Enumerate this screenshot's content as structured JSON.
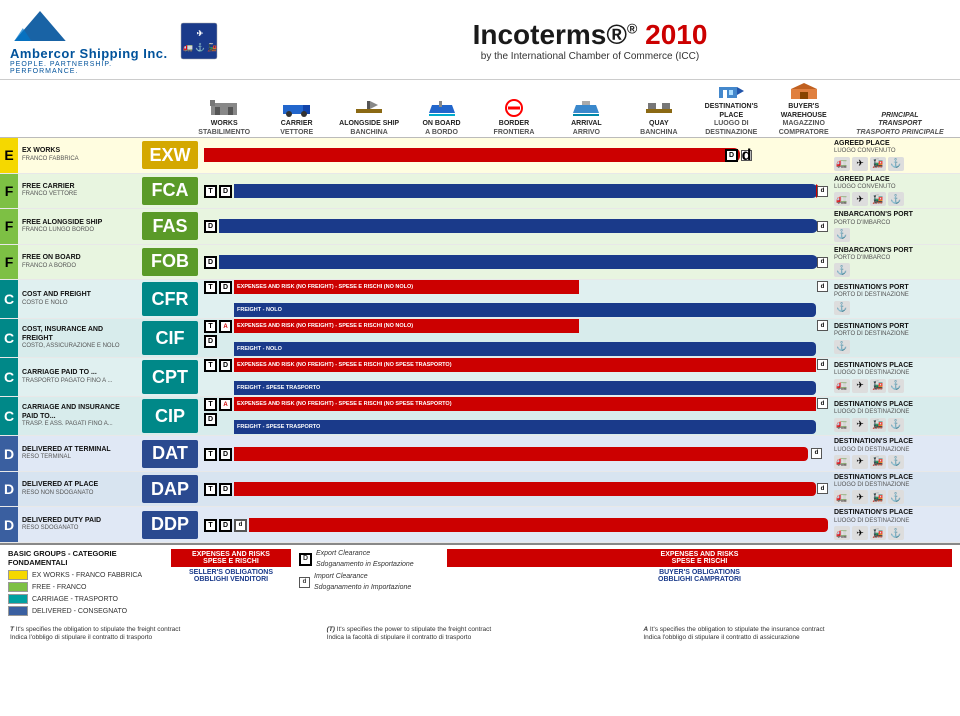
{
  "header": {
    "company": "Ambercor Shipping Inc.",
    "tagline": "PEOPLE. PARTNERSHIP. PERFORMANCE.",
    "title": "Incoterms®",
    "year": "2010",
    "subtitle": "by the International Chamber of Commerce (ICC)"
  },
  "columns": [
    {
      "main": "WORKS",
      "sub": "STABILIMENTO",
      "icon": "factory"
    },
    {
      "main": "CARRIER",
      "sub": "VETTORE",
      "icon": "truck"
    },
    {
      "main": "ALONGSIDE SHIP",
      "sub": "BANCHINA",
      "icon": "dock"
    },
    {
      "main": "ON BOARD",
      "sub": "A BORDO",
      "icon": "ship"
    },
    {
      "main": "BORDER",
      "sub": "FRONTIERA",
      "icon": "border"
    },
    {
      "main": "ARRIVAL",
      "sub": "ARRIVO",
      "icon": "arrival"
    },
    {
      "main": "QUAY",
      "sub": "BANCHINA",
      "icon": "quay"
    },
    {
      "main": "DESTINATION'S PLACE",
      "sub": "LUOGO DI DESTINAZIONE",
      "icon": "dest"
    },
    {
      "main": "BUYER'S WAREHOUSE",
      "sub": "MAGAZZINO COMPRATORE",
      "icon": "warehouse"
    }
  ],
  "last_col": {
    "main": "PRINCIPAL TRANSPORT",
    "sub": "TRASPORTO PRINCIPALE"
  },
  "rows": [
    {
      "group": "E",
      "group_color": "yellow",
      "code": "EXW",
      "desc_main": "EX WORKS",
      "desc_sub": "FRANCO FABBRICA",
      "right_main": "AGREED PLACE",
      "right_sub": "LUOGO CONVENUTO",
      "bar_type": "exw"
    },
    {
      "group": "F",
      "group_color": "green",
      "code": "FCA",
      "desc_main": "FREE CARRIER",
      "desc_sub": "FRANCO VETTORE",
      "right_main": "AGREED PLACE",
      "right_sub": "LUOGO CONVENUTO",
      "bar_type": "fca"
    },
    {
      "group": "F",
      "group_color": "green",
      "code": "FAS",
      "desc_main": "FREE ALONGSIDE SHIP",
      "desc_sub": "FRANCO LUNGO BORDO",
      "right_main": "ENBARCATION'S PORT",
      "right_sub": "PORTO D'IMBARCO",
      "bar_type": "fas"
    },
    {
      "group": "F",
      "group_color": "green",
      "code": "FOB",
      "desc_main": "FREE ON BOARD",
      "desc_sub": "FRANCO A BORDO",
      "right_main": "ENBARCATION'S PORT",
      "right_sub": "PORTO D'IMBARCO",
      "bar_type": "fob"
    },
    {
      "group": "C",
      "group_color": "teal",
      "code": "CFR",
      "desc_main": "COST AND FREIGHT",
      "desc_sub": "COSTO E NOLO",
      "right_main": "DESTINATION'S PORT",
      "right_sub": "PORTO DI DESTINAZIONE",
      "bar_type": "cfr"
    },
    {
      "group": "C",
      "group_color": "teal",
      "code": "CIF",
      "desc_main": "COST, INSURANCE AND FREIGHT",
      "desc_sub": "COSTO, ASSICURAZIONE E NOLO",
      "right_main": "DESTINATION'S PORT",
      "right_sub": "PORTO DI DESTINAZIONE",
      "bar_type": "cif"
    },
    {
      "group": "C",
      "group_color": "teal",
      "code": "CPT",
      "desc_main": "CARRIAGE PAID TO ...",
      "desc_sub": "TRASPORTO PAGATO FINO A ...",
      "right_main": "DESTINATION'S PLACE",
      "right_sub": "LUOGO DI DESTINAZIONE",
      "bar_type": "cpt"
    },
    {
      "group": "C",
      "group_color": "teal",
      "code": "CIP",
      "desc_main": "CARRIAGE AND INSURANCE PAID TO...",
      "desc_sub": "TRASP. E ASS. PAGATI FINO A...",
      "right_main": "DESTINATION'S PLACE",
      "right_sub": "LUOGO DI DESTINAZIONE",
      "bar_type": "cip"
    },
    {
      "group": "D",
      "group_color": "blue",
      "code": "DAT",
      "desc_main": "DELIVERED AT TERMINAL",
      "desc_sub": "RESO TERMINAL",
      "right_main": "DESTINATION'S PLACE",
      "right_sub": "LUOGO DI DESTINAZIONE",
      "bar_type": "dat"
    },
    {
      "group": "D",
      "group_color": "blue",
      "code": "DAP",
      "desc_main": "DELIVERED AT PLACE",
      "desc_sub": "RESO NON SDOGANATO",
      "right_main": "DESTINATION'S PLACE",
      "right_sub": "LUOGO DI DESTINAZIONE",
      "bar_type": "dap"
    },
    {
      "group": "D",
      "group_color": "blue",
      "code": "DDP",
      "desc_main": "DELIVERED DUTY PAID",
      "desc_sub": "RESO SDOGANATO",
      "right_main": "DESTINATION'S PLACE",
      "right_sub": "LUOGO DI DESTINAZIONE",
      "bar_type": "ddp"
    }
  ],
  "legend": {
    "title": "BASIC GROUPS - CATEGORIE FONDAMENTALI",
    "items": [
      {
        "color": "#f5d800",
        "text": "EX WORKS - FRANCO FABBRICA"
      },
      {
        "color": "#7dc044",
        "text": "FREE - FRANCO"
      },
      {
        "color": "#00a0a0",
        "text": "CARRIAGE - TRASPORTO"
      },
      {
        "color": "#3a5fa0",
        "text": "DELIVERED - CONSEGNATO"
      }
    ]
  },
  "notes": {
    "seller_label": "EXPENSES AND RISKS\nSPESE E RISCHI",
    "seller_oblig": "SELLER'S OBLIGATIONS\nOBBLIGHI VENDITORI",
    "buyer_label": "EXPENSES AND RISKS\nSPESE E RISCHI",
    "buyer_oblig": "BUYER'S OBLIGATIONS\nOBBLIGHI CAMPRATORI",
    "export_d": "Export Clearance\nSdoganamento in Esportazione",
    "import_d": "Import Clearance\nSdoganamento in Importazione",
    "note_t": "T  It's specifies the obligation to stipulate the freight contract\nIndica l'obbligo di stipulare il contratto di trasporto",
    "note_t2": "(T)  It's specifies the power to stipulate the freight contract\nIndica la facoltà di stipulare il contratto di trasporto",
    "note_a": "A  It's specifies the obligation to stipulate the insurance contract\nIndica l'obbligo di stipulare il contratto di assicurazione"
  }
}
